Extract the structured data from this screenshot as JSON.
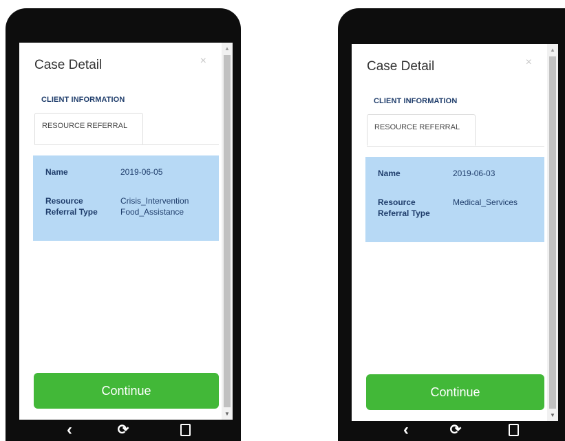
{
  "phones": [
    {
      "modal_title": "Case Detail",
      "close_icon": "×",
      "tab_client": "CLIENT INFORMATION",
      "tab_resource": "RESOURCE REFERRAL",
      "fields": [
        {
          "label": "Name",
          "value": "2019-06-05"
        },
        {
          "label": "Resource\nReferral\nType",
          "value": "Crisis_Intervention\nFood_Assistance"
        }
      ],
      "continue_label": "Continue"
    },
    {
      "modal_title": "Case Detail",
      "close_icon": "×",
      "tab_client": "CLIENT INFORMATION",
      "tab_resource": "RESOURCE REFERRAL",
      "fields": [
        {
          "label": "Name",
          "value": "2019-06-03"
        },
        {
          "label": "Resource\nReferral Type",
          "value": "Medical_Services"
        }
      ],
      "continue_label": "Continue"
    }
  ],
  "nav": {
    "back_icon": "‹",
    "refresh_icon": "⟳",
    "back_name": "back-icon",
    "refresh_name": "refresh-icon",
    "square_name": "recent-apps-icon"
  },
  "scrollbar": {
    "up": "▲",
    "down": "▼"
  },
  "colors": {
    "phone_frame": "#0d0d0d",
    "card_bg": "#b7d9f5",
    "continue_bg": "#42b838",
    "label_text": "#1f3d6b"
  }
}
